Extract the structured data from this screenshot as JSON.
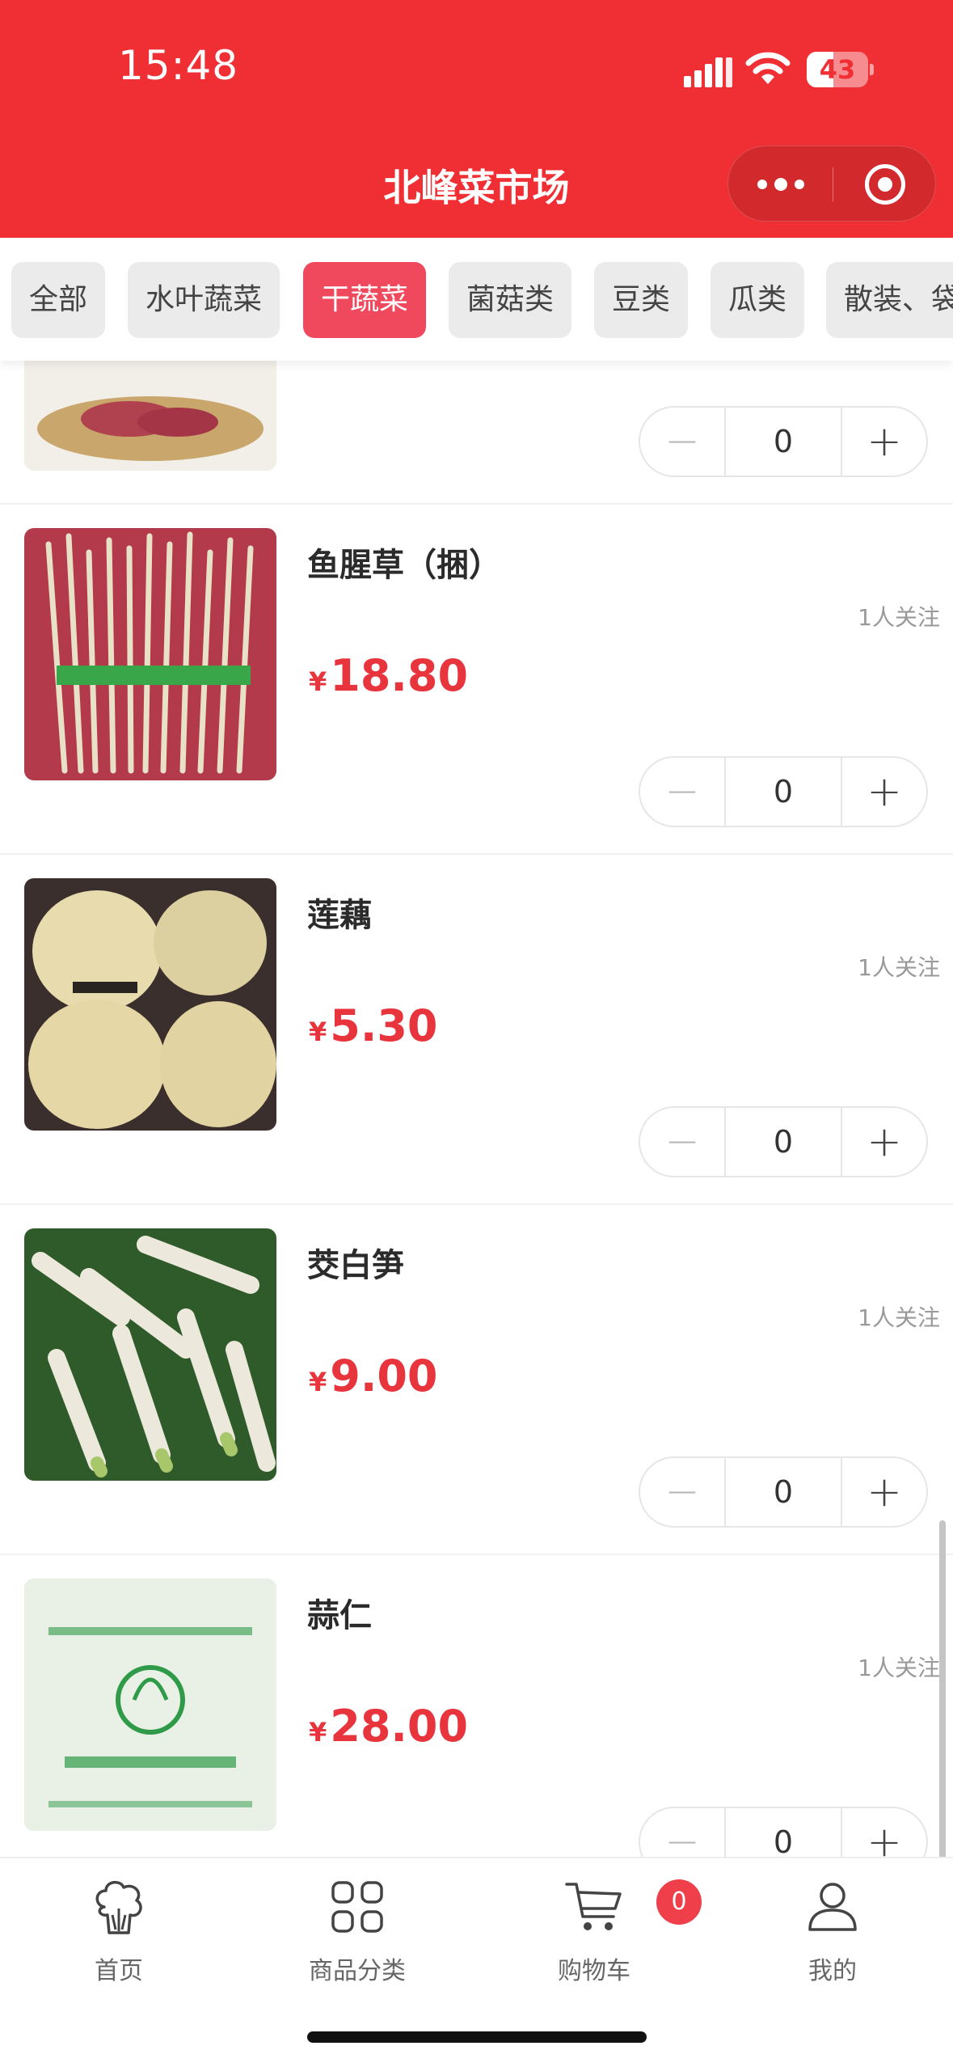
{
  "status_bar": {
    "time": "15:48",
    "battery_level": "43",
    "battery_fraction": 0.43,
    "icons": [
      "signal-icon",
      "wifi-icon",
      "battery-icon"
    ]
  },
  "header": {
    "title": "北峰菜市场",
    "capsule_icons": [
      "more-dots-icon",
      "close-target-icon"
    ]
  },
  "categories": [
    {
      "label": "全部",
      "active": false
    },
    {
      "label": "水叶蔬菜",
      "active": false
    },
    {
      "label": "干蔬菜",
      "active": true
    },
    {
      "label": "菌菇类",
      "active": false
    },
    {
      "label": "豆类",
      "active": false
    },
    {
      "label": "瓜类",
      "active": false
    },
    {
      "label": "散装、袋",
      "active": false
    }
  ],
  "products": [
    {
      "name": "",
      "follow": "",
      "currency": "¥",
      "price": "",
      "qty": "0"
    },
    {
      "name": "鱼腥草（捆）",
      "follow": "1人关注",
      "currency": "¥",
      "price": "18.80",
      "qty": "0"
    },
    {
      "name": "莲藕",
      "follow": "1人关注",
      "currency": "¥",
      "price": "5.30",
      "qty": "0"
    },
    {
      "name": "茭白笋",
      "follow": "1人关注",
      "currency": "¥",
      "price": "9.00",
      "qty": "0"
    },
    {
      "name": "蒜仁",
      "follow": "1人关注",
      "currency": "¥",
      "price": "28.00",
      "qty": "0"
    }
  ],
  "stepper": {
    "minus": "−",
    "plus": "+"
  },
  "tabbar": {
    "items": [
      {
        "label": "首页",
        "icon": "vegetable-home-icon"
      },
      {
        "label": "商品分类",
        "icon": "grid-category-icon"
      },
      {
        "label": "购物车",
        "icon": "cart-icon"
      },
      {
        "label": "我的",
        "icon": "user-profile-icon"
      }
    ],
    "cart_count": "0"
  },
  "colors": {
    "brand_red": "#ef2f34",
    "active_chip": "#f0485c",
    "price_red": "#e8343d"
  }
}
